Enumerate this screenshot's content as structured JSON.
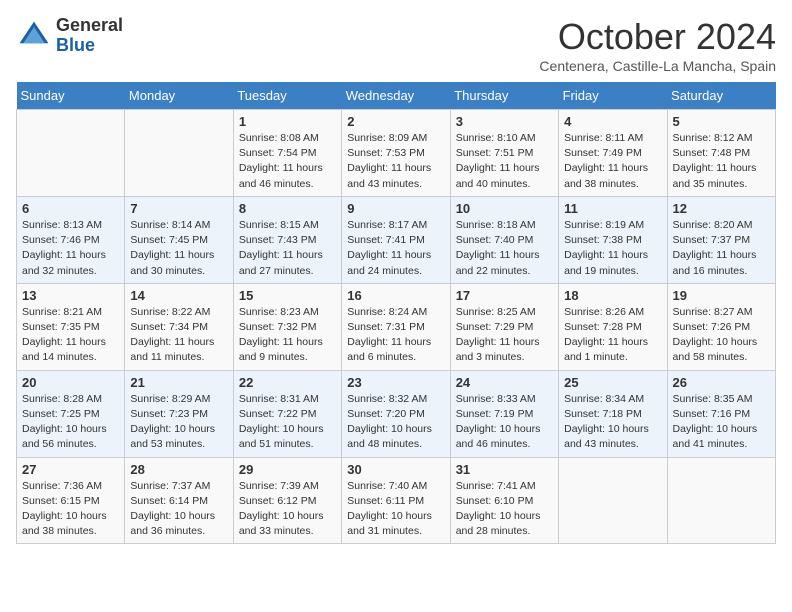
{
  "header": {
    "logo": {
      "general": "General",
      "blue": "Blue"
    },
    "title": "October 2024",
    "location": "Centenera, Castille-La Mancha, Spain"
  },
  "days_of_week": [
    "Sunday",
    "Monday",
    "Tuesday",
    "Wednesday",
    "Thursday",
    "Friday",
    "Saturday"
  ],
  "weeks": [
    [
      {
        "day": "",
        "info": ""
      },
      {
        "day": "",
        "info": ""
      },
      {
        "day": "1",
        "info": "Sunrise: 8:08 AM\nSunset: 7:54 PM\nDaylight: 11 hours and 46 minutes."
      },
      {
        "day": "2",
        "info": "Sunrise: 8:09 AM\nSunset: 7:53 PM\nDaylight: 11 hours and 43 minutes."
      },
      {
        "day": "3",
        "info": "Sunrise: 8:10 AM\nSunset: 7:51 PM\nDaylight: 11 hours and 40 minutes."
      },
      {
        "day": "4",
        "info": "Sunrise: 8:11 AM\nSunset: 7:49 PM\nDaylight: 11 hours and 38 minutes."
      },
      {
        "day": "5",
        "info": "Sunrise: 8:12 AM\nSunset: 7:48 PM\nDaylight: 11 hours and 35 minutes."
      }
    ],
    [
      {
        "day": "6",
        "info": "Sunrise: 8:13 AM\nSunset: 7:46 PM\nDaylight: 11 hours and 32 minutes."
      },
      {
        "day": "7",
        "info": "Sunrise: 8:14 AM\nSunset: 7:45 PM\nDaylight: 11 hours and 30 minutes."
      },
      {
        "day": "8",
        "info": "Sunrise: 8:15 AM\nSunset: 7:43 PM\nDaylight: 11 hours and 27 minutes."
      },
      {
        "day": "9",
        "info": "Sunrise: 8:17 AM\nSunset: 7:41 PM\nDaylight: 11 hours and 24 minutes."
      },
      {
        "day": "10",
        "info": "Sunrise: 8:18 AM\nSunset: 7:40 PM\nDaylight: 11 hours and 22 minutes."
      },
      {
        "day": "11",
        "info": "Sunrise: 8:19 AM\nSunset: 7:38 PM\nDaylight: 11 hours and 19 minutes."
      },
      {
        "day": "12",
        "info": "Sunrise: 8:20 AM\nSunset: 7:37 PM\nDaylight: 11 hours and 16 minutes."
      }
    ],
    [
      {
        "day": "13",
        "info": "Sunrise: 8:21 AM\nSunset: 7:35 PM\nDaylight: 11 hours and 14 minutes."
      },
      {
        "day": "14",
        "info": "Sunrise: 8:22 AM\nSunset: 7:34 PM\nDaylight: 11 hours and 11 minutes."
      },
      {
        "day": "15",
        "info": "Sunrise: 8:23 AM\nSunset: 7:32 PM\nDaylight: 11 hours and 9 minutes."
      },
      {
        "day": "16",
        "info": "Sunrise: 8:24 AM\nSunset: 7:31 PM\nDaylight: 11 hours and 6 minutes."
      },
      {
        "day": "17",
        "info": "Sunrise: 8:25 AM\nSunset: 7:29 PM\nDaylight: 11 hours and 3 minutes."
      },
      {
        "day": "18",
        "info": "Sunrise: 8:26 AM\nSunset: 7:28 PM\nDaylight: 11 hours and 1 minute."
      },
      {
        "day": "19",
        "info": "Sunrise: 8:27 AM\nSunset: 7:26 PM\nDaylight: 10 hours and 58 minutes."
      }
    ],
    [
      {
        "day": "20",
        "info": "Sunrise: 8:28 AM\nSunset: 7:25 PM\nDaylight: 10 hours and 56 minutes."
      },
      {
        "day": "21",
        "info": "Sunrise: 8:29 AM\nSunset: 7:23 PM\nDaylight: 10 hours and 53 minutes."
      },
      {
        "day": "22",
        "info": "Sunrise: 8:31 AM\nSunset: 7:22 PM\nDaylight: 10 hours and 51 minutes."
      },
      {
        "day": "23",
        "info": "Sunrise: 8:32 AM\nSunset: 7:20 PM\nDaylight: 10 hours and 48 minutes."
      },
      {
        "day": "24",
        "info": "Sunrise: 8:33 AM\nSunset: 7:19 PM\nDaylight: 10 hours and 46 minutes."
      },
      {
        "day": "25",
        "info": "Sunrise: 8:34 AM\nSunset: 7:18 PM\nDaylight: 10 hours and 43 minutes."
      },
      {
        "day": "26",
        "info": "Sunrise: 8:35 AM\nSunset: 7:16 PM\nDaylight: 10 hours and 41 minutes."
      }
    ],
    [
      {
        "day": "27",
        "info": "Sunrise: 7:36 AM\nSunset: 6:15 PM\nDaylight: 10 hours and 38 minutes."
      },
      {
        "day": "28",
        "info": "Sunrise: 7:37 AM\nSunset: 6:14 PM\nDaylight: 10 hours and 36 minutes."
      },
      {
        "day": "29",
        "info": "Sunrise: 7:39 AM\nSunset: 6:12 PM\nDaylight: 10 hours and 33 minutes."
      },
      {
        "day": "30",
        "info": "Sunrise: 7:40 AM\nSunset: 6:11 PM\nDaylight: 10 hours and 31 minutes."
      },
      {
        "day": "31",
        "info": "Sunrise: 7:41 AM\nSunset: 6:10 PM\nDaylight: 10 hours and 28 minutes."
      },
      {
        "day": "",
        "info": ""
      },
      {
        "day": "",
        "info": ""
      }
    ]
  ]
}
